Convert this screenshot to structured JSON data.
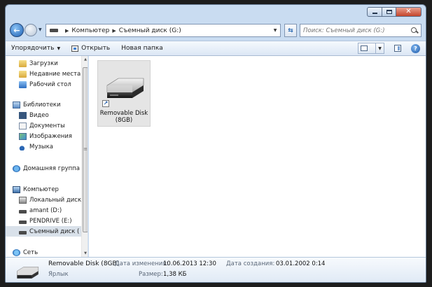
{
  "address": {
    "crumbs": [
      "Компьютер",
      "Съемный диск (G:)"
    ],
    "search_placeholder": "Поиск: Съемный диск (G:)"
  },
  "toolbar": {
    "organize_label": "Упорядочить",
    "open_label": "Открыть",
    "new_folder_label": "Новая папка"
  },
  "nav": {
    "favorites": [
      {
        "label": "Загрузки",
        "icon": "downloads-folder-icon"
      },
      {
        "label": "Недавние места",
        "icon": "recent-places-icon"
      },
      {
        "label": "Рабочий стол",
        "icon": "desktop-icon"
      }
    ],
    "libraries": {
      "label": "Библиотеки",
      "items": [
        {
          "label": "Видео",
          "icon": "video-icon"
        },
        {
          "label": "Документы",
          "icon": "documents-icon"
        },
        {
          "label": "Изображения",
          "icon": "images-icon"
        },
        {
          "label": "Музыка",
          "icon": "music-icon"
        }
      ]
    },
    "homegroup": {
      "label": "Домашняя группа"
    },
    "computer": {
      "label": "Компьютер",
      "items": [
        {
          "label": "Локальный диск"
        },
        {
          "label": "amant (D:)"
        },
        {
          "label": "PENDRIVE (E:)"
        },
        {
          "label": "Съемный диск ("
        }
      ]
    },
    "network": {
      "label": "Сеть"
    }
  },
  "content": {
    "file": {
      "name_line1": "Removable Disk",
      "name_line2": "(8GB)"
    }
  },
  "details": {
    "name": "Removable Disk (8GB)",
    "type": "Ярлык",
    "modified_label": "Дата изменения:",
    "modified_value": "10.06.2013 12:30",
    "size_label": "Размер:",
    "size_value": "1,38 КБ",
    "created_label": "Дата создания:",
    "created_value": "03.01.2002 0:14"
  }
}
